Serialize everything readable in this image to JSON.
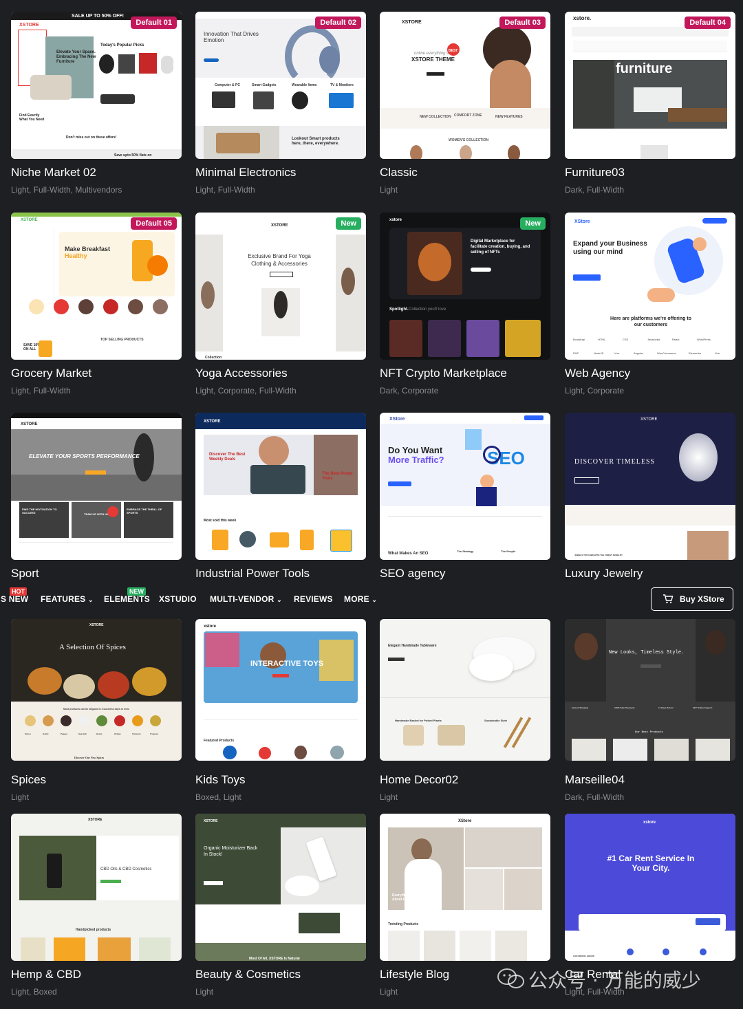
{
  "colors": {
    "background": "#1e1f22",
    "badge_default": "#c2185b",
    "badge_new": "#27ae60",
    "hot": "#e53935",
    "new_nav": "#27ae60"
  },
  "cards": [
    {
      "title": "Niche Market 02",
      "subtitle": "Light, Full-Width, Multivendors",
      "badge": "Default 01",
      "thumb": {
        "headline": "Elevate Your Space. Embracing The New Furniture",
        "small": "Today's Popular Picks",
        "banner": "SALE UP TO 50% OFF!",
        "logo": "XSTORE",
        "foot1": "Find Exactly What You Need",
        "foot2": "Don't miss out on these offers!",
        "foot3": "Save upto 50% flats on"
      }
    },
    {
      "title": "Minimal Electronics",
      "subtitle": "Light, Full-Width",
      "badge": "Default 02",
      "thumb": {
        "headline": "Innovation That Drives Emotion",
        "cat1": "Computer & PC",
        "cat2": "Smart Gadgets",
        "cat3": "Wearable Items",
        "cat4": "TV & Monitors",
        "foot": "Lookout Smart products here, there, everywhere."
      }
    },
    {
      "title": "Classic",
      "subtitle": "Light",
      "badge": "Default 03",
      "thumb": {
        "headline": "XSTORE THEME",
        "script": "online everything shop",
        "logo": "XSTORE",
        "bubble": "BEST",
        "c1": "NEW COLLECTION",
        "c2": "COMFORT ZONE",
        "c3": "NEW FEATURES",
        "c4": "WOMEN'S COLLECTION"
      }
    },
    {
      "title": "Furniture03",
      "subtitle": "Dark, Full-Width",
      "badge": "Default 04",
      "thumb": {
        "headline": "furniture",
        "logo": "xstore."
      }
    },
    {
      "title": "Grocery Market",
      "subtitle": "Light, Full-Width",
      "badge": "Default 05",
      "thumb": {
        "headline": "Make Breakfast",
        "headline2": "Healthy",
        "logo": "XSTORE",
        "sale": "SAVE 10% ON ALL",
        "foot": "TOP SELLING PRODUCTS"
      }
    },
    {
      "title": "Yoga Accessories",
      "subtitle": "Light, Corporate, Full-Width",
      "badge": "New",
      "thumb": {
        "headline": "Exclusive Brand For Yoga Clothing & Accessories",
        "logo": "XSTORE",
        "foot": "Collection"
      }
    },
    {
      "title": "NFT Crypto Marketplace",
      "subtitle": "Dark, Corporate",
      "badge": "New",
      "thumb": {
        "headline": "Digital Marketplace for facilitate creation, buying, and selling of NFTs",
        "spot": "Spotlight.",
        "spot2": "Collection you'll love",
        "logo": "xstore"
      }
    },
    {
      "title": "Web Agency",
      "subtitle": "Light, Corporate",
      "badge": "",
      "thumb": {
        "headline": "Expand your Business using our mind",
        "logo": "XStore",
        "platform": "Here are platforms we're offering to our customers",
        "brands": [
          "Bootstrap",
          "HTML",
          "CSS",
          "Javascript",
          "React",
          "WordPress",
          "PHP",
          "NodeJS",
          "Vue",
          "Angular",
          "WooCommerce",
          "Elementor",
          "Vue"
        ]
      }
    },
    {
      "title": "Sport",
      "subtitle": "",
      "badge": "",
      "thumb": {
        "headline": "ELEVATE YOUR SPORTS PERFORMANCE",
        "p1": "FIND THE MOTIVATION TO SUCCEED",
        "p2": "TEAM UP WITH US",
        "p3": "EMBRACE THE THRILL OF SPORTS",
        "logo": "XSTORE"
      }
    },
    {
      "title": "Industrial Power Tools",
      "subtitle": "",
      "badge": "",
      "thumb": {
        "headline": "Discover The Best Weekly Deals",
        "power": "The Best Power Tools",
        "sold": "Most sold this week",
        "logo": "XSTORE"
      }
    },
    {
      "title": "SEO agency",
      "subtitle": "",
      "badge": "",
      "thumb": {
        "headline": "Do You Want",
        "headline2": "More Traffic?",
        "seo": "SEO",
        "foot": "What Makes An SEO",
        "foot2": "The Strategy",
        "foot3": "The People",
        "logo": "XStore"
      }
    },
    {
      "title": "Luxury Jewelry",
      "subtitle": "",
      "badge": "",
      "thumb": {
        "headline": "DISCOVER TIMELESS",
        "logo": "XSTORE",
        "foot": "JEWELS TOUCHED WITH THE FINEST JEWELRY"
      }
    },
    {
      "title": "Spices",
      "subtitle": "Light",
      "badge": "",
      "thumb": {
        "headline": "A Selection Of Spices",
        "logo": "XSTORE",
        "foot": "Most products can be shipped in 3 business days or less!",
        "foot2": "Discover Our New Spices",
        "spices": [
          "Onion",
          "Garlic",
          "Pepper",
          "Sea Salt",
          "Herbs",
          "Chilies",
          "Turmeric",
          "Tropical"
        ]
      }
    },
    {
      "title": "Kids Toys",
      "subtitle": "Boxed, Light",
      "badge": "",
      "thumb": {
        "headline": "INTERACTIVE TOYS",
        "logo": "xstore",
        "foot": "Featured Products"
      }
    },
    {
      "title": "Home Decor02",
      "subtitle": "Light",
      "badge": "",
      "thumb": {
        "headline": "Elegant Handmade Tableware",
        "mid": "Handmade Basket for Potted Plants",
        "mid2": "Sustainable Style"
      }
    },
    {
      "title": "Marseille04",
      "subtitle": "Dark, Full-Width",
      "badge": "",
      "thumb": {
        "headline": "New Looks, Timeless Style.",
        "foot": "Our Best Products",
        "f1": "Fastest Shipping",
        "f2": "100% Safe Payments",
        "f3": "14 Days Return",
        "f4": "24/7 Online Support"
      }
    },
    {
      "title": "Hemp & CBD",
      "subtitle": "Light, Boxed",
      "badge": "",
      "thumb": {
        "headline": "CBD Oils & CBD Cosmetics",
        "logo": "XSTORE",
        "foot": "Handpicked products"
      }
    },
    {
      "title": "Beauty & Cosmetics",
      "subtitle": "Light",
      "badge": "",
      "thumb": {
        "headline": "Organic Moisturizer Back In Stock!",
        "logo": "XSTORE",
        "foot": "Most Of All, XSTORE Is Natural"
      }
    },
    {
      "title": "Lifestyle Blog",
      "subtitle": "Light",
      "badge": "",
      "thumb": {
        "headline": "Everything You Need Know About Fashion",
        "logo": "XStore",
        "foot": "Trending Products"
      }
    },
    {
      "title": "Car Rental",
      "subtitle": "Light, Full-Width",
      "badge": "",
      "thumb": {
        "headline": "#1 Car Rent Service In Your City.",
        "logo": "xstore",
        "foot": "CAR RENTAL GROUP"
      }
    }
  ],
  "nav": {
    "items": [
      "S NEW",
      "FEATURES",
      "ELEMENTS",
      "XSTUDIO",
      "MULTI-VENDOR",
      "REVIEWS",
      "MORE"
    ],
    "hot": "HOT",
    "new": "NEW",
    "buy": "Buy XStore"
  },
  "watermark": "公众号 · 万能的威少"
}
